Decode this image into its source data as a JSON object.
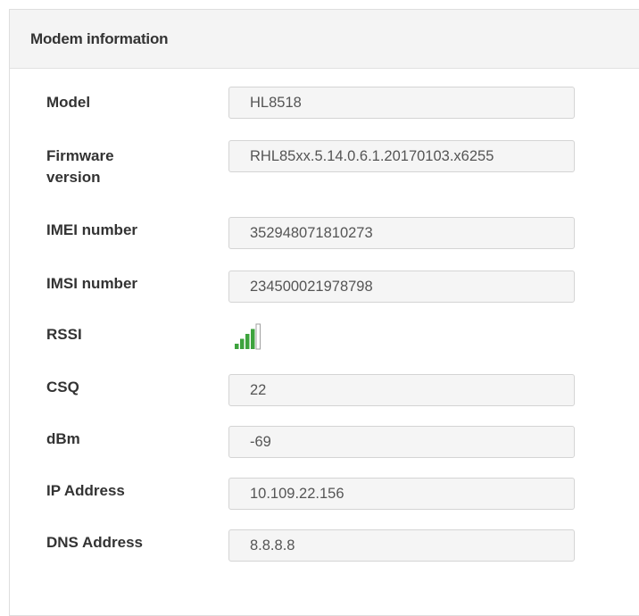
{
  "panel": {
    "title": "Modem information"
  },
  "fields": {
    "model": {
      "label": "Model",
      "value": "HL8518"
    },
    "firmware": {
      "label_line1": "Firmware",
      "label_line2": "version",
      "value": "RHL85xx.5.14.0.6.1.20170103.x6255"
    },
    "imei": {
      "label": "IMEI number",
      "value": "352948071810273"
    },
    "imsi": {
      "label": "IMSI number",
      "value": "234500021978798"
    },
    "rssi": {
      "label": "RSSI",
      "bars_filled": 4,
      "bars_total": 5,
      "active_color": "#3da33d",
      "inactive_color": "#ffffff"
    },
    "csq": {
      "label": "CSQ",
      "value": "22"
    },
    "dbm": {
      "label": "dBm",
      "value": "-69"
    },
    "ip": {
      "label": "IP Address",
      "value": "10.109.22.156"
    },
    "dns": {
      "label": "DNS Address",
      "value": "8.8.8.8"
    }
  }
}
